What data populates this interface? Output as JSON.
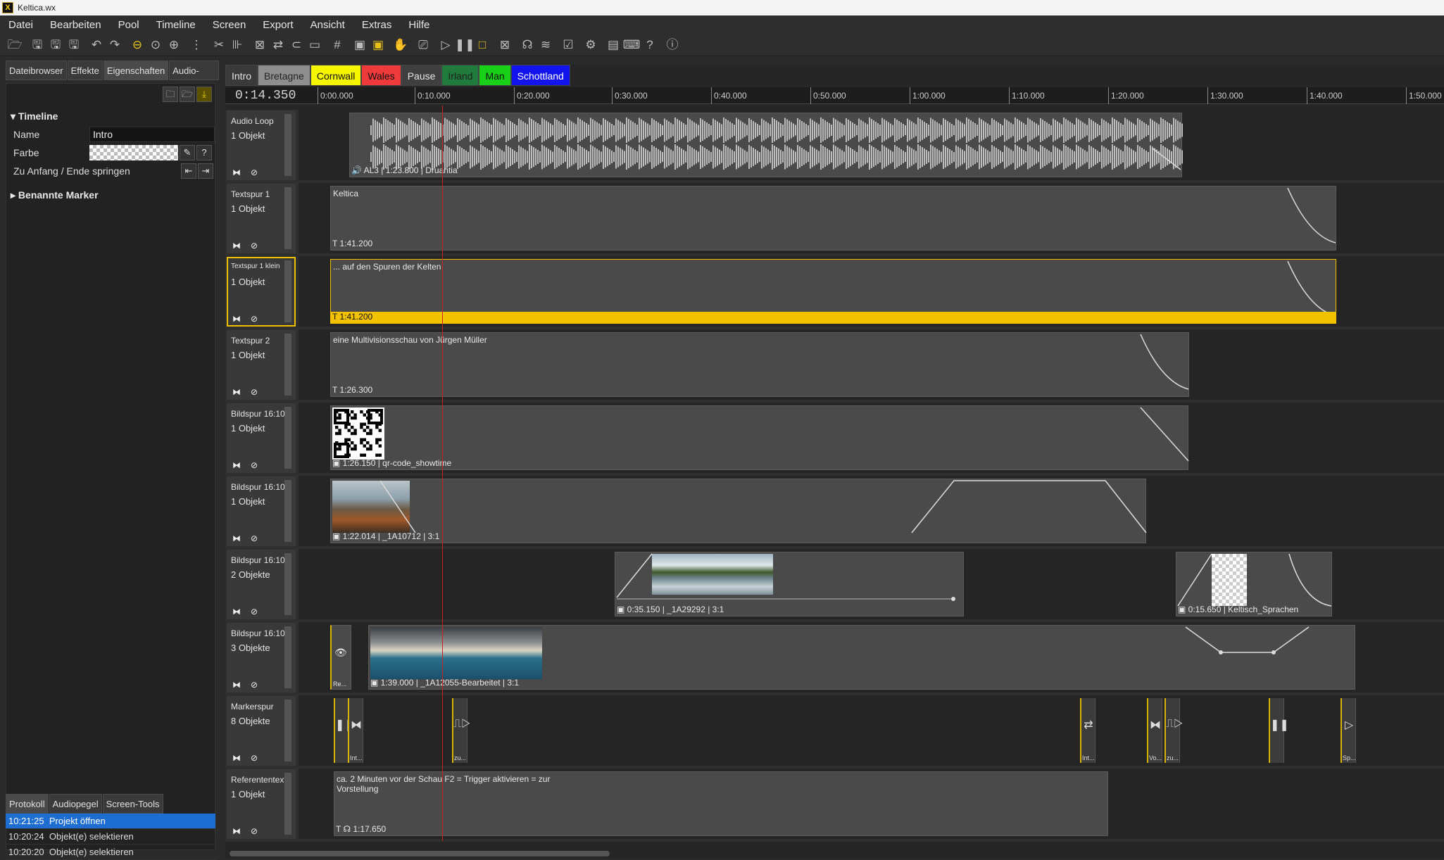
{
  "app": {
    "title": "Keltica.wx"
  },
  "menu": [
    "Datei",
    "Bearbeiten",
    "Pool",
    "Timeline",
    "Screen",
    "Export",
    "Ansicht",
    "Extras",
    "Hilfe"
  ],
  "toolbar_icons": [
    "open-icon",
    "save-icon",
    "save-as-icon",
    "save-all-icon",
    "undo-icon",
    "redo-icon",
    "zoom-out-icon",
    "zoom-fit-icon",
    "zoom-in-icon",
    "grid-align-icon",
    "cut-icon",
    "split-icon",
    "crop-icon",
    "swap-icon",
    "magnet-icon",
    "ruler-icon",
    "grid-icon",
    "screen-icon",
    "monitor-icon",
    "hand-icon",
    "clapper-icon",
    "play-icon",
    "pause-icon",
    "stop-icon",
    "close-window-icon",
    "remote-icon",
    "wifi-icon",
    "checklist-icon",
    "settings-icon",
    "comments-icon",
    "keyboard-icon",
    "help-icon",
    "info-icon"
  ],
  "left_tabs": [
    "Dateibrowser",
    "Effekte",
    "Eigenschaften",
    "Audio-Plugins"
  ],
  "properties": {
    "section": "Timeline",
    "name_label": "Name",
    "name_value": "Intro",
    "color_label": "Farbe",
    "jump_label": "Zu Anfang / Ende springen",
    "named_markers": "Benannte Marker"
  },
  "bottom_tabs": [
    "Protokoll",
    "Audiopegel",
    "Screen-Tools"
  ],
  "log": [
    {
      "time": "10:21:25",
      "text": "Projekt öffnen"
    },
    {
      "time": "10:20:24",
      "text": "Objekt(e) selektieren"
    },
    {
      "time": "10:20:20",
      "text": "Objekt(e) selektieren"
    }
  ],
  "tabs": [
    {
      "label": "Intro",
      "color": "#3a3a3a",
      "text": "#e6e6e6"
    },
    {
      "label": "Bretagne",
      "color": "#8e8e8e",
      "text": "#222222"
    },
    {
      "label": "Cornwall",
      "color": "#f5f500",
      "text": "#111111"
    },
    {
      "label": "Wales",
      "color": "#ee3a3a",
      "text": "#111111"
    },
    {
      "label": "Pause",
      "color": "#3f3f3f",
      "text": "#e6e6e6"
    },
    {
      "label": "Irland",
      "color": "#1f7a3c",
      "text": "#222222"
    },
    {
      "label": "Man",
      "color": "#17d017",
      "text": "#111111"
    },
    {
      "label": "Schottland",
      "color": "#1313ee",
      "text": "#ffffff"
    }
  ],
  "ruler": {
    "current_time": "0:14.350",
    "ticks": [
      "0:00.000",
      "0:10.000",
      "0:20.000",
      "0:30.000",
      "0:40.000",
      "0:50.000",
      "1:00.000",
      "1:10.000",
      "1:20.000",
      "1:30.000",
      "1:40.000",
      "1:50.000"
    ]
  },
  "tracks": [
    {
      "name": "Audio Loop",
      "count": "1 Objekt",
      "footer": "AL3 | 1:23.800 | Druantia"
    },
    {
      "name": "Textspur 1",
      "count": "1 Objekt",
      "label": "Keltica",
      "footer": "1:41.200"
    },
    {
      "name": "Textspur 1 klein",
      "count": "1 Objekt",
      "label": "... auf den Spuren der Kelten",
      "footer": "1:41.200"
    },
    {
      "name": "Textspur 2",
      "count": "1 Objekt",
      "label": "eine Multivisionsschau von Jürgen Müller",
      "footer": "1:26.300"
    },
    {
      "name": "Bildspur 16:10",
      "count": "1 Objekt",
      "footer": "1:26.150 | qr-code_showtime"
    },
    {
      "name": "Bildspur 16:10",
      "count": "1 Objekt",
      "footer": "1:22.014 | _1A10712 | 3:1"
    },
    {
      "name": "Bildspur 16:10",
      "count": "2 Objekte",
      "footer_a": "0:35.150 | _1A29292 | 3:1",
      "footer_b": "0:15.650 | Keltisch_Sprachen"
    },
    {
      "name": "Bildspur 16:10",
      "count": "3 Objekte",
      "footer": "1:39.000 | _1A12055-Bearbeitet | 3:1",
      "small": "Re..."
    },
    {
      "name": "Markerspur",
      "count": "8 Objekte",
      "markers": [
        "Int...",
        "zu...",
        "Int...",
        "Vo...",
        "zu...",
        "Sp..."
      ]
    },
    {
      "name": "Referententext",
      "count": "1 Objekt",
      "label": "ca. 2 Minuten vor der Schau F2 = Trigger aktivieren = zur Vorstellung",
      "footer": "1:17.650"
    }
  ]
}
